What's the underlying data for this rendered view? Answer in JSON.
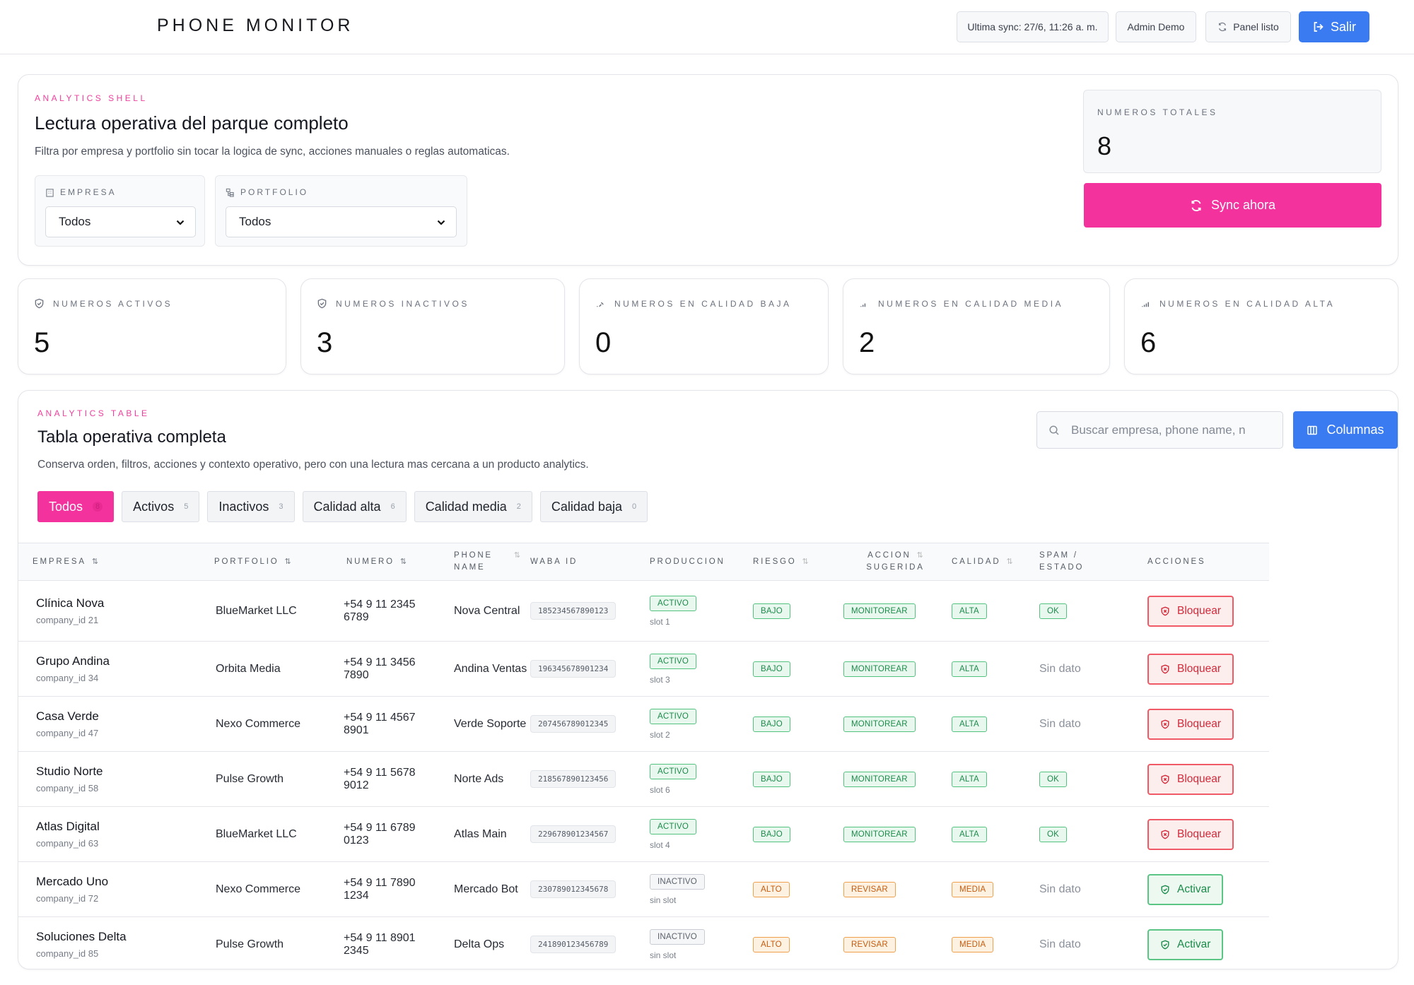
{
  "header": {
    "brand": "PHONE MONITOR",
    "last_sync": "Ultima sync: 27/6, 11:26 a. m.",
    "user": "Admin Demo",
    "panel_status": "Panel listo",
    "logout": "Salir"
  },
  "shell": {
    "eyebrow": "ANALYTICS SHELL",
    "title": "Lectura operativa del parque completo",
    "subtitle": "Filtra por empresa y portfolio sin tocar la logica de sync, acciones manuales o reglas automaticas.",
    "filters": {
      "empresa_label": "EMPRESA",
      "empresa_value": "Todos",
      "portfolio_label": "PORTFOLIO",
      "portfolio_value": "Todos"
    },
    "total_label": "NUMEROS TOTALES",
    "total_value": "8",
    "sync_button": "Sync ahora"
  },
  "stats": [
    {
      "label": "NUMEROS ACTIVOS",
      "value": "5"
    },
    {
      "label": "NUMEROS INACTIVOS",
      "value": "3"
    },
    {
      "label": "NUMEROS EN CALIDAD BAJA",
      "value": "0"
    },
    {
      "label": "NUMEROS EN CALIDAD MEDIA",
      "value": "2"
    },
    {
      "label": "NUMEROS EN CALIDAD ALTA",
      "value": "6"
    }
  ],
  "table_section": {
    "eyebrow": "ANALYTICS TABLE",
    "title": "Tabla operativa completa",
    "subtitle": "Conserva orden, filtros, acciones y contexto operativo, pero con una lectura mas cercana a un producto analytics.",
    "search_placeholder": "Buscar empresa, phone name, n",
    "columns_button": "Columnas",
    "chips": [
      {
        "label": "Todos",
        "count": "8"
      },
      {
        "label": "Activos",
        "count": "5"
      },
      {
        "label": "Inactivos",
        "count": "3"
      },
      {
        "label": "Calidad alta",
        "count": "6"
      },
      {
        "label": "Calidad media",
        "count": "2"
      },
      {
        "label": "Calidad baja",
        "count": "0"
      }
    ],
    "headers": {
      "empresa": "EMPRESA",
      "portfolio": "PORTFOLIO",
      "numero": "NUMERO",
      "phone_1": "PHONE",
      "phone_2": "NAME",
      "waba": "WABA ID",
      "produccion": "PRODUCCION",
      "riesgo": "RIESGO",
      "accion_1": "ACCION",
      "accion_2": "SUGERIDA",
      "calidad": "CALIDAD",
      "spam_1": "SPAM /",
      "spam_2": "ESTADO",
      "acciones": "ACCIONES"
    },
    "rows": [
      {
        "empresa": "Clínica Nova",
        "company_id": "company_id 21",
        "portfolio": "BlueMarket LLC",
        "numero": "+54 9 11 2345 6789",
        "phone_name": "Nova Central",
        "waba": "185234567890123",
        "produccion": "ACTIVO",
        "slot": "slot 1",
        "riesgo": "BAJO",
        "accion": "MONITOREAR",
        "calidad": "ALTA",
        "spam": "OK",
        "action": "Bloquear"
      },
      {
        "empresa": "Grupo Andina",
        "company_id": "company_id 34",
        "portfolio": "Orbita Media",
        "numero": "+54 9 11 3456 7890",
        "phone_name": "Andina Ventas",
        "waba": "196345678901234",
        "produccion": "ACTIVO",
        "slot": "slot 3",
        "riesgo": "BAJO",
        "accion": "MONITOREAR",
        "calidad": "ALTA",
        "spam": "Sin dato",
        "action": "Bloquear"
      },
      {
        "empresa": "Casa Verde",
        "company_id": "company_id 47",
        "portfolio": "Nexo Commerce",
        "numero": "+54 9 11 4567 8901",
        "phone_name": "Verde Soporte",
        "waba": "207456789012345",
        "produccion": "ACTIVO",
        "slot": "slot 2",
        "riesgo": "BAJO",
        "accion": "MONITOREAR",
        "calidad": "ALTA",
        "spam": "Sin dato",
        "action": "Bloquear"
      },
      {
        "empresa": "Studio Norte",
        "company_id": "company_id 58",
        "portfolio": "Pulse Growth",
        "numero": "+54 9 11 5678 9012",
        "phone_name": "Norte Ads",
        "waba": "218567890123456",
        "produccion": "ACTIVO",
        "slot": "slot 6",
        "riesgo": "BAJO",
        "accion": "MONITOREAR",
        "calidad": "ALTA",
        "spam": "OK",
        "action": "Bloquear"
      },
      {
        "empresa": "Atlas Digital",
        "company_id": "company_id 63",
        "portfolio": "BlueMarket LLC",
        "numero": "+54 9 11 6789 0123",
        "phone_name": "Atlas Main",
        "waba": "229678901234567",
        "produccion": "ACTIVO",
        "slot": "slot 4",
        "riesgo": "BAJO",
        "accion": "MONITOREAR",
        "calidad": "ALTA",
        "spam": "OK",
        "action": "Bloquear"
      },
      {
        "empresa": "Mercado Uno",
        "company_id": "company_id 72",
        "portfolio": "Nexo Commerce",
        "numero": "+54 9 11 7890 1234",
        "phone_name": "Mercado Bot",
        "waba": "230789012345678",
        "produccion": "INACTIVO",
        "slot": "sin slot",
        "riesgo": "ALTO",
        "accion": "REVISAR",
        "calidad": "MEDIA",
        "spam": "Sin dato",
        "action": "Activar"
      },
      {
        "empresa": "Soluciones Delta",
        "company_id": "company_id 85",
        "portfolio": "Pulse Growth",
        "numero": "+54 9 11 8901 2345",
        "phone_name": "Delta Ops",
        "waba": "241890123456789",
        "produccion": "INACTIVO",
        "slot": "sin slot",
        "riesgo": "ALTO",
        "accion": "REVISAR",
        "calidad": "MEDIA",
        "spam": "Sin dato",
        "action": "Activar"
      }
    ]
  },
  "colors": {
    "pink": "#f4329e",
    "blue": "#3b7bf2",
    "green": "#1b8a4a",
    "orange": "#c55a0e",
    "red": "#d22a3a"
  }
}
